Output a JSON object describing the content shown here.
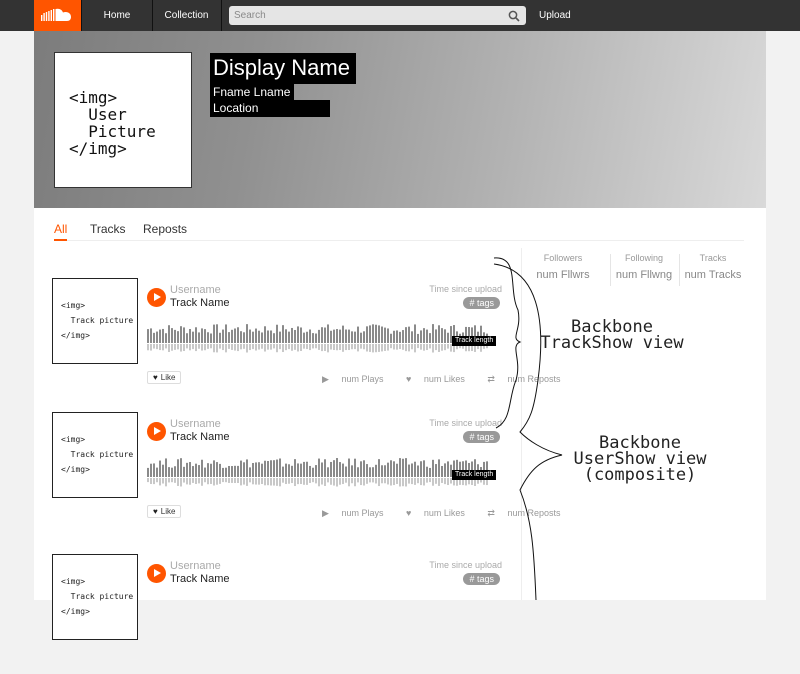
{
  "topbar": {
    "logo_icon": "soundcloud-cloud-icon",
    "home": "Home",
    "collection": "Collection",
    "search_placeholder": "Search",
    "upload": "Upload"
  },
  "profile": {
    "picture_text": "<img>\n  User\n  Picture\n</img>",
    "display_name": "Display Name",
    "full_name": "Fname Lname",
    "location": "Location"
  },
  "tabs": [
    "All",
    "Tracks",
    "Reposts"
  ],
  "stats": [
    {
      "label": "Followers",
      "value": "num Fllwrs"
    },
    {
      "label": "Following",
      "value": "num Fllwng"
    },
    {
      "label": "Tracks",
      "value": "num Tracks"
    }
  ],
  "tracks": [
    {
      "picture_text": "<img>\n  Track picture\n</img>",
      "username": "Username",
      "track_name": "Track Name",
      "time": "Time since upload",
      "tags": "# tags",
      "length": "Track length",
      "like": "Like",
      "plays": "num Plays",
      "likes": "num Likes",
      "reposts": "num Reposts"
    },
    {
      "picture_text": "<img>\n  Track picture\n</img>",
      "username": "Username",
      "track_name": "Track Name",
      "time": "Time since upload",
      "tags": "# tags",
      "length": "Track length",
      "like": "Like",
      "plays": "num Plays",
      "likes": "num Likes",
      "reposts": "num Reposts"
    },
    {
      "picture_text": "<img>\n  Track picture\n</img>",
      "username": "Username",
      "track_name": "Track Name",
      "time": "Time since upload",
      "tags": "# tags"
    }
  ],
  "annotations": {
    "trackshow": "Backbone\nTrackShow view",
    "usershow": "Backbone\nUserShow view\n(composite)"
  },
  "colors": {
    "accent": "#ff5500",
    "topbar": "#333333"
  }
}
